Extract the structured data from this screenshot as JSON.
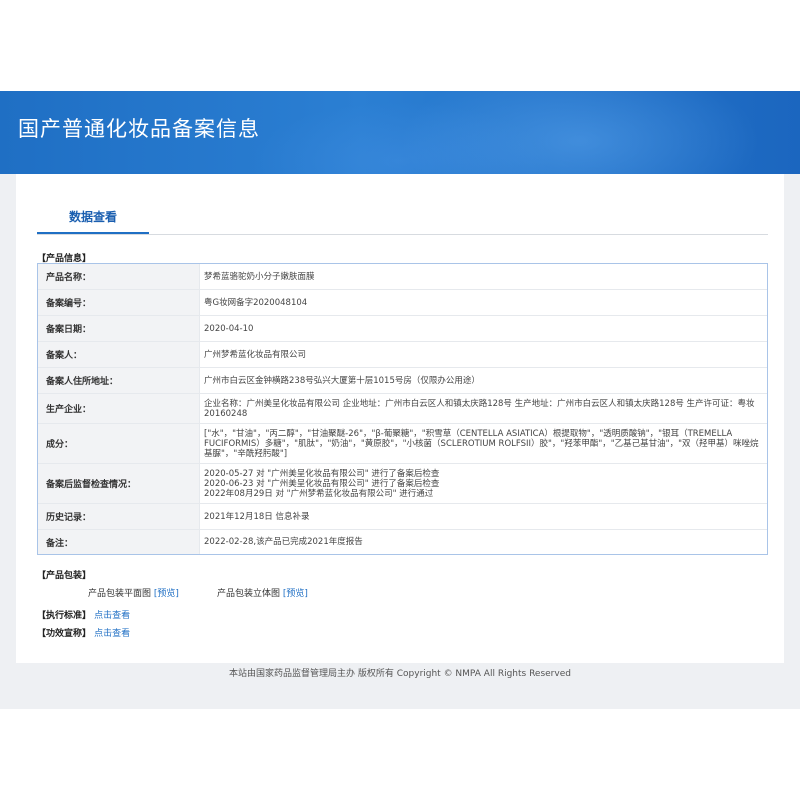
{
  "header": {
    "title": "国产普通化妆品备案信息"
  },
  "tabs": [
    {
      "label": "数据查看"
    }
  ],
  "product_info": {
    "section_label": "【产品信息】",
    "rows": [
      {
        "label": "产品名称：",
        "value": "梦希蓝骆驼奶小分子嫩肤面膜"
      },
      {
        "label": "备案编号：",
        "value": "粤G妆网备字2020048104"
      },
      {
        "label": "备案日期：",
        "value": "2020-04-10"
      },
      {
        "label": "备案人：",
        "value": "广州梦希蓝化妆品有限公司"
      },
      {
        "label": "备案人住所地址：",
        "value": "广州市白云区金钟横路238号弘兴大厦第十层1015号房（仅限办公用途）"
      },
      {
        "label": "生产企业：",
        "value": "企业名称：广州美呈化妆品有限公司 企业地址：广州市白云区人和镇太庆路128号 生产地址：广州市白云区人和镇太庆路128号 生产许可证：粤妆20160248"
      },
      {
        "label": "成分：",
        "value": "[\"水\"，\"甘油\"，\"丙二醇\"，\"甘油聚醚-26\"，\"β-葡聚糖\"，\"积雪草（CENTELLA ASIATICA）根提取物\"，\"透明质酸钠\"，\"银耳（TREMELLA FUCIFORMIS）多糖\"，\"肌肽\"，\"奶油\"，\"黄原胶\"，\"小核菌（SCLEROTIUM ROLFSII）胶\"，\"羟苯甲酯\"，\"乙基己基甘油\"，\"双（羟甲基）咪唑烷基脲\"，\"辛酰羟肟酸\"]"
      },
      {
        "label": "备案后监督检查情况：",
        "value": "2020-05-27 对 \"广州美呈化妆品有限公司\" 进行了备案后检查\n2020-06-23 对 \"广州美呈化妆品有限公司\" 进行了备案后检查\n2022年08月29日 对 \"广州梦希蓝化妆品有限公司\" 进行通过"
      },
      {
        "label": "历史记录：",
        "value": "2021年12月18日 信息补录"
      },
      {
        "label": "备注：",
        "value": "2022-02-28,该产品已完成2021年度报告"
      }
    ]
  },
  "packaging": {
    "section_label": "【产品包装】",
    "flat_label": "产品包装平面图",
    "flat_link": "[预览]",
    "solid_label": "产品包装立体图",
    "solid_link": "[预览]"
  },
  "standard": {
    "section_label": "【执行标准】",
    "link": "点击查看"
  },
  "efficacy": {
    "section_label": "【功效宣称】",
    "link": "点击查看"
  },
  "footer": {
    "text": "本站由国家药品监督管理局主办 版权所有 Copyright © NMPA All Rights Reserved"
  },
  "colors": {
    "banner": "#1f6fc4",
    "link": "#1f6fc4",
    "table_border": "#a9c4e8"
  }
}
